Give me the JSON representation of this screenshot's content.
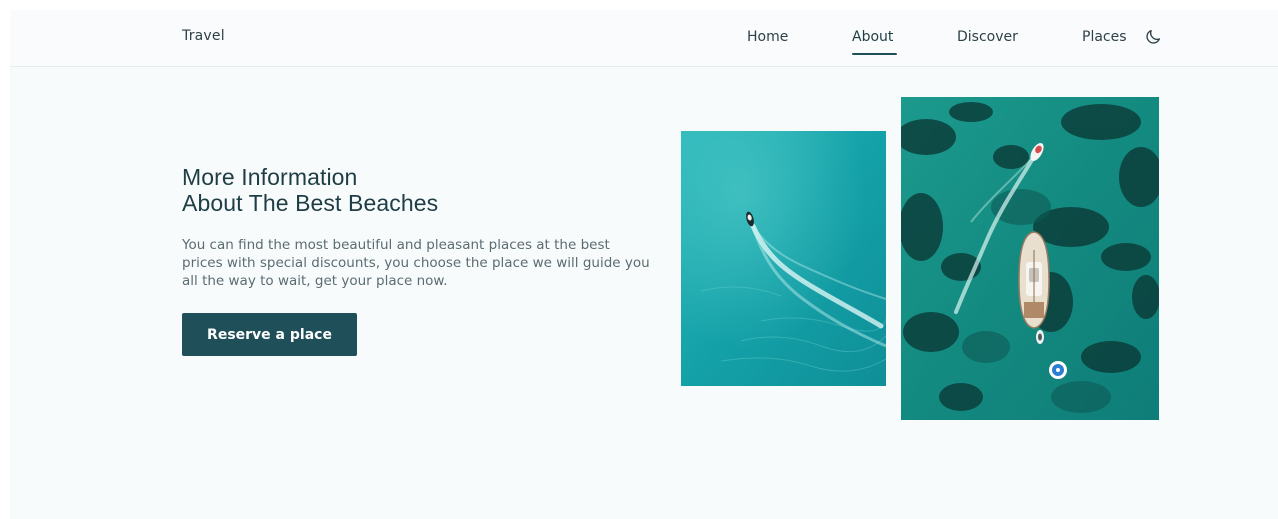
{
  "header": {
    "logo": "Travel",
    "nav": [
      {
        "label": "Home"
      },
      {
        "label": "About",
        "active": true
      },
      {
        "label": "Discover"
      },
      {
        "label": "Places"
      }
    ],
    "theme_icon": "moon-icon"
  },
  "hero": {
    "title_line1": "More Information",
    "title_line2": "About The Best Beaches",
    "description": "You can find the most beautiful and pleasant places at the best prices with special discounts, you choose the place we will guide you all the way to wait, get your place now.",
    "cta_label": "Reserve a place"
  },
  "colors": {
    "accent": "#1f4f59",
    "heading": "#1f3d45",
    "text": "#5b6c72",
    "background": "#f8fbfc"
  },
  "images": {
    "small": "aerial-boat-turquoise-sea",
    "large": "aerial-yacht-reef"
  }
}
